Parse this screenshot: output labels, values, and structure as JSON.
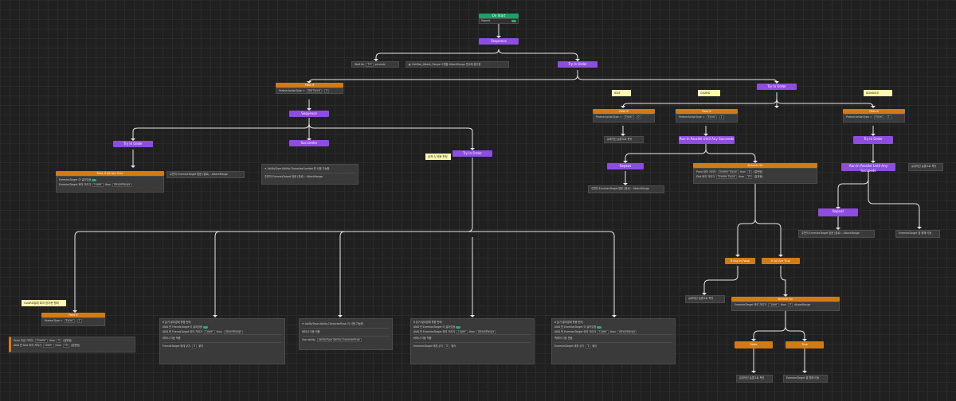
{
  "root": {
    "title": "On Start",
    "field_label": "Repeat"
  },
  "seq_main": "Sequence",
  "top_row": {
    "wait": "Wait for",
    "wait_value": "3.0",
    "wait_unit": "seconds",
    "get_stat": "GetStat_Attack_Range",
    "get_stat_value": "스탯을 AttackRange 변수에 출기한"
  },
  "try_top": "Try In Order",
  "pass_if_left": {
    "title": "Pass If",
    "cond": "PartnerActionType",
    "cond_op": "Not Equal",
    "cond_val": "0"
  },
  "seq_left": "Sequence",
  "try_left": "Try In Order",
  "succeeder": "Succeeder",
  "try_mid": "Try In Order",
  "note_mid": "공격 & 적용 판정",
  "pass_all": {
    "title": "Pass If All Are True",
    "row1_label": "EnemiesTarget 이 살아있음",
    "row2_label": "EnemiesTarget 와의 거리가",
    "row2_op": "Lower",
    "row2_than": "than",
    "row2_var": "AttackRange"
  },
  "left_plain": "주변의 EnemiesTarget 방문 (경로) : AttackRange",
  "ability_box": {
    "row1": "AbilityType.Ability.CharacterCombat",
    "row1_tail": "를 사용 가능함",
    "row2": "주변의 EnemiesTarget 방문 (경로) : AttackRange"
  },
  "try_right_top": "Try In Order",
  "labels": {
    "idle": "IDLE",
    "guard": "GUARD",
    "advance": "ADVANCE"
  },
  "pass_idle": {
    "title": "Pass If",
    "cond": "PartnerActionType",
    "op": "Equal",
    "val": "0"
  },
  "pass_guard": {
    "title": "Pass If",
    "cond": "PartnerActionType",
    "op": "Equal",
    "val": "1"
  },
  "pass_adv": {
    "title": "Pass If",
    "cond": "PartnerActionType",
    "op": "Equal",
    "val": "2"
  },
  "idle_text": "유계적인 슬롯으로 복귀",
  "run_guard": "Run In Parallel Until Any Succeeds",
  "repeat_guard": "Repeat",
  "guard_text": "주변의 EnemiesTarget 방문 (경로) : AttackRange",
  "branch_on": {
    "title": "Branch On",
    "row1": "Point",
    "row1_tail": "와의 거리가",
    "row1_op": "Greater Equal",
    "row1_than": "than",
    "row1_val": "8",
    "row1_end": "(잘못됨)",
    "row2": "Dist",
    "row2_tail": "와의 거리가",
    "row2_op": "Greater Equal",
    "row2_than": "than",
    "row2_val": "10",
    "row2_end": "(잘못됨)"
  },
  "any_false": "If Any Is False",
  "all_true": "If All Are True",
  "return_text": "유계적인 슬롯으로 복귀",
  "branch_on2": {
    "title": "Branch On",
    "row": "EnemiesTarget",
    "row_tail": "와의 거리가",
    "row_op": "Lower",
    "row_than": "than",
    "row_val": "0",
    "row_var": "AttackRange"
  },
  "false_node": "False",
  "true_node": "True",
  "false_text": "유계적인 슬롯으로 복귀",
  "true_text": "EnemiesTarget 을 향해 이동",
  "try_adv": "Try In Order",
  "run_adv": "Run In Parallel Until Any Succeeds",
  "adv_side": "유계적인 슬롯으로 복귀",
  "repeat_adv": "Repeat",
  "adv_text1": "주변의 EnemiesTarget 방문 (경로) : AttackRange",
  "adv_text2": "EnemiesTarget 을 향해 이동",
  "note_left": "GUARD일때 특지 방지용 행위",
  "pass_bottom": {
    "title": "Pass If",
    "cond": "PartnerType",
    "op": "Equal",
    "val": "1"
  },
  "bottom_left": {
    "row1": "Point",
    "row1_mid": "조금 가까이",
    "row1_op": "Greater",
    "row1_than": "than",
    "row1_val": "0",
    "row1_end": "(잘못됨)",
    "row2": "AND 만",
    "row2_mid": "Dist",
    "row2_tail": "와의 거리가",
    "row2_op": "Lower",
    "row2_than": "than",
    "row2_val": "10",
    "row2_end": "(잘못됨)"
  },
  "bottom_box1": {
    "head": "8 분기",
    "head2": "멀티경제 활용 판매",
    "r1": "AND 만 FriendsTarget 이 살아있음",
    "r2": "AND 만 FriendsTarget 와의 거리가",
    "r2_op": "Lower",
    "r2_than": "than",
    "r2_var": "AttackRange",
    "s1": "바하나 이동 적중",
    "s2": "FriendsTarget 에게 쿠기",
    "s2_val": "0",
    "s2_tail": "쌓이"
  },
  "bottom_box2": {
    "head": "AbilityType.Ability.CharacterRush",
    "head2": "이 사용 가능함",
    "s1": "바하나 이동 적중",
    "s2": "Use ability",
    "s2_val": "AbilityType.Ability.CharacterRush"
  },
  "bottom_box3": {
    "head": "8 분기",
    "head2": "멀티경제 활용 판매",
    "r1": "AND 만 EnemiesTarget 이 살아있음",
    "r2": "AND 만 EnemiesTarget 와의 거리가",
    "r2_op": "Lower",
    "r2_than": "than",
    "r2_var": "AttackRange",
    "s1": "바하나 이동 적중",
    "s2": "EnemiesTarget 에게 쿠기",
    "s2_val": "0",
    "s2_tail": "쌓이"
  },
  "bottom_box4": {
    "head": "8 분기",
    "head2": "멀티경제 활용 판매",
    "r1": "AND 만 EnemiesTarget 이 살아있음",
    "r2": "AND 만 EnemiesTarget 와의 거리가",
    "r2_op": "Lower",
    "r2_than": "than",
    "r2_var": "AttackRange",
    "s1": "백제의 이동 반환",
    "s2": "EnemiesTarget 에게 쿠기",
    "s2_val": "1",
    "s2_tail": "쌓이"
  }
}
